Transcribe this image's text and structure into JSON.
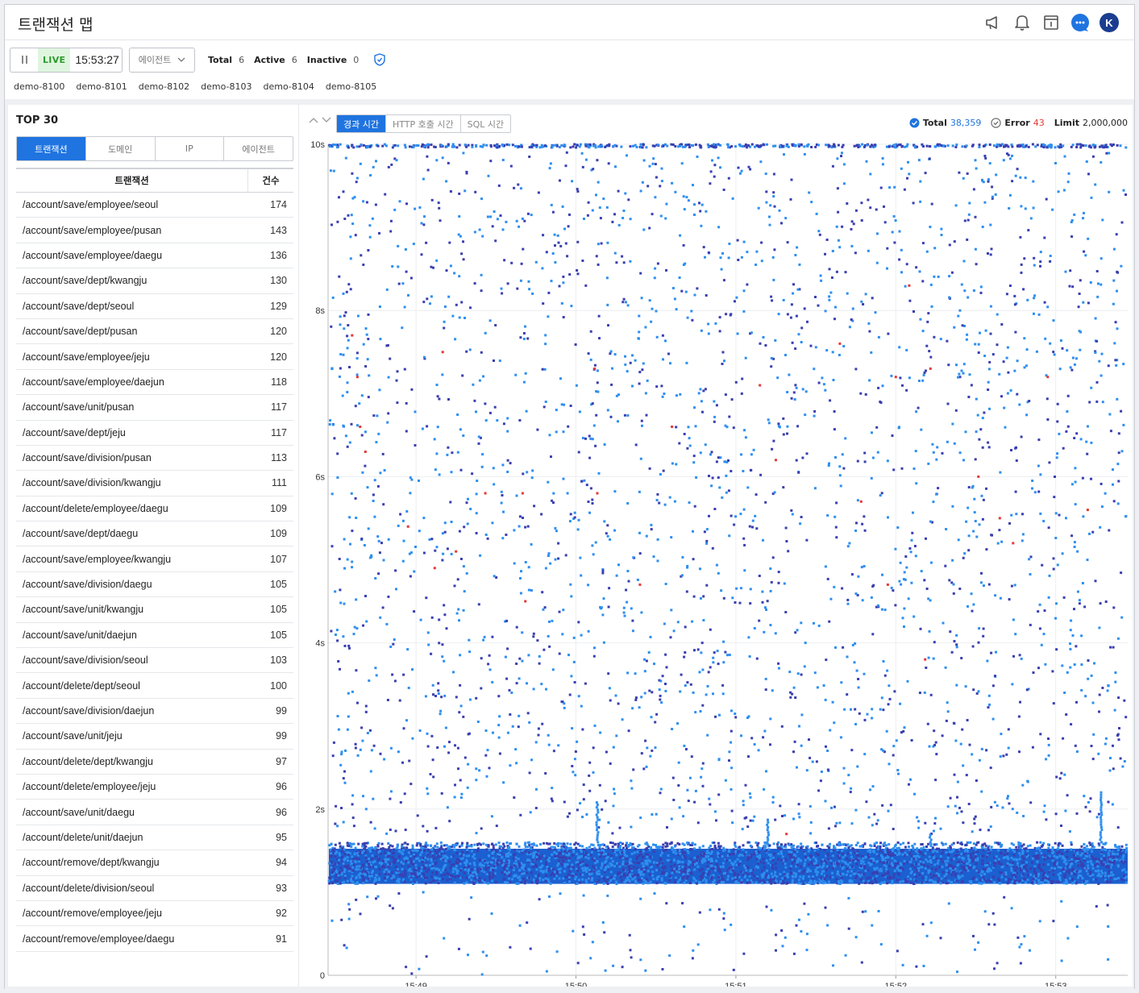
{
  "app": {
    "title": "트랜잭션 맵"
  },
  "header_icons": [
    "megaphone-icon",
    "bell-icon",
    "window-icon",
    "chat-icon",
    "avatar"
  ],
  "avatar_letter": "K",
  "toolbar": {
    "live_label": "LIVE",
    "time": "15:53:27",
    "agent_select": "에이전트",
    "total_label": "Total",
    "total_value": "6",
    "active_label": "Active",
    "active_value": "6",
    "inactive_label": "Inactive",
    "inactive_value": "0"
  },
  "agents": [
    "demo-8100",
    "demo-8101",
    "demo-8102",
    "demo-8103",
    "demo-8104",
    "demo-8105"
  ],
  "top": {
    "title": "TOP 30",
    "tabs": [
      "트랜잭션",
      "도메인",
      "IP",
      "에이전트"
    ],
    "active_tab": 0,
    "columns": [
      "트랜잭션",
      "건수"
    ],
    "rows": [
      [
        "/account/save/employee/seoul",
        "174"
      ],
      [
        "/account/save/employee/pusan",
        "143"
      ],
      [
        "/account/save/employee/daegu",
        "136"
      ],
      [
        "/account/save/dept/kwangju",
        "130"
      ],
      [
        "/account/save/dept/seoul",
        "129"
      ],
      [
        "/account/save/dept/pusan",
        "120"
      ],
      [
        "/account/save/employee/jeju",
        "120"
      ],
      [
        "/account/save/employee/daejun",
        "118"
      ],
      [
        "/account/save/unit/pusan",
        "117"
      ],
      [
        "/account/save/dept/jeju",
        "117"
      ],
      [
        "/account/save/division/pusan",
        "113"
      ],
      [
        "/account/save/division/kwangju",
        "111"
      ],
      [
        "/account/delete/employee/daegu",
        "109"
      ],
      [
        "/account/save/dept/daegu",
        "109"
      ],
      [
        "/account/save/employee/kwangju",
        "107"
      ],
      [
        "/account/save/division/daegu",
        "105"
      ],
      [
        "/account/save/unit/kwangju",
        "105"
      ],
      [
        "/account/save/unit/daejun",
        "105"
      ],
      [
        "/account/save/division/seoul",
        "103"
      ],
      [
        "/account/delete/dept/seoul",
        "100"
      ],
      [
        "/account/save/division/daejun",
        "99"
      ],
      [
        "/account/save/unit/jeju",
        "99"
      ],
      [
        "/account/delete/dept/kwangju",
        "97"
      ],
      [
        "/account/delete/employee/jeju",
        "96"
      ],
      [
        "/account/save/unit/daegu",
        "96"
      ],
      [
        "/account/delete/unit/daejun",
        "95"
      ],
      [
        "/account/remove/dept/kwangju",
        "94"
      ],
      [
        "/account/delete/division/seoul",
        "93"
      ],
      [
        "/account/remove/employee/jeju",
        "92"
      ],
      [
        "/account/remove/employee/daegu",
        "91"
      ]
    ]
  },
  "chart_tabs": [
    "경과 시간",
    "HTTP 호출 시간",
    "SQL 시간"
  ],
  "chart_active_tab": 0,
  "legend": {
    "total_label": "Total",
    "total_value": "38,359",
    "error_label": "Error",
    "error_value": "43",
    "limit_label": "Limit",
    "limit_value": "2,000,000"
  },
  "colors": {
    "accent": "#1f74e0",
    "point_light": "#2e8fef",
    "point_dark": "#3a3fb0",
    "error": "#e53935",
    "total_value": "#1f74e0",
    "error_value": "#e53935"
  },
  "chart_data": {
    "type": "scatter",
    "x_ticks": [
      "15:49",
      "15:50",
      "15:51",
      "15:52",
      "15:53"
    ],
    "y_ticks": [
      "0",
      "2s",
      "4s",
      "6s",
      "8s",
      "10s"
    ],
    "ylim": [
      0,
      10
    ],
    "xlim": [
      "15:48:27",
      "15:53:27"
    ],
    "grid": true,
    "dense_band_seconds": [
      1.1,
      1.6
    ],
    "error_points_sample": [
      {
        "x": "15:48:36",
        "y": 7.7
      },
      {
        "x": "15:48:38",
        "y": 7.2
      },
      {
        "x": "15:48:39",
        "y": 6.6
      },
      {
        "x": "15:48:41",
        "y": 6.3
      },
      {
        "x": "15:48:57",
        "y": 5.4
      },
      {
        "x": "15:49:07",
        "y": 4.9
      },
      {
        "x": "15:49:10",
        "y": 7.5
      },
      {
        "x": "15:49:15",
        "y": 5.1
      },
      {
        "x": "15:49:26",
        "y": 5.8
      },
      {
        "x": "15:49:41",
        "y": 4.5
      },
      {
        "x": "15:49:40",
        "y": 5.8
      },
      {
        "x": "15:50:07",
        "y": 7.3
      },
      {
        "x": "15:50:08",
        "y": 5.8
      },
      {
        "x": "15:50:24",
        "y": 4.7
      },
      {
        "x": "15:50:36",
        "y": 6.6
      },
      {
        "x": "15:51:09",
        "y": 7.1
      },
      {
        "x": "15:51:15",
        "y": 6.2
      },
      {
        "x": "15:51:19",
        "y": 1.7
      },
      {
        "x": "15:51:39",
        "y": 7.6
      },
      {
        "x": "15:51:47",
        "y": 5.7
      },
      {
        "x": "15:51:57",
        "y": 4.7
      },
      {
        "x": "15:52:05",
        "y": 8.3
      },
      {
        "x": "15:52:00",
        "y": 7.2
      },
      {
        "x": "15:52:11",
        "y": 3.8
      },
      {
        "x": "15:52:13",
        "y": 7.3
      },
      {
        "x": "15:52:31",
        "y": 6.0
      },
      {
        "x": "15:52:39",
        "y": 5.5
      },
      {
        "x": "15:52:44",
        "y": 5.2
      },
      {
        "x": "15:53:12",
        "y": 5.6
      },
      {
        "x": "15:52:57",
        "y": 7.2
      }
    ],
    "spikes": [
      {
        "x": "15:50:08",
        "top": 2.1
      },
      {
        "x": "15:51:12",
        "top": 1.9
      },
      {
        "x": "15:52:13",
        "top": 1.7
      },
      {
        "x": "15:53:17",
        "top": 2.2
      }
    ]
  }
}
